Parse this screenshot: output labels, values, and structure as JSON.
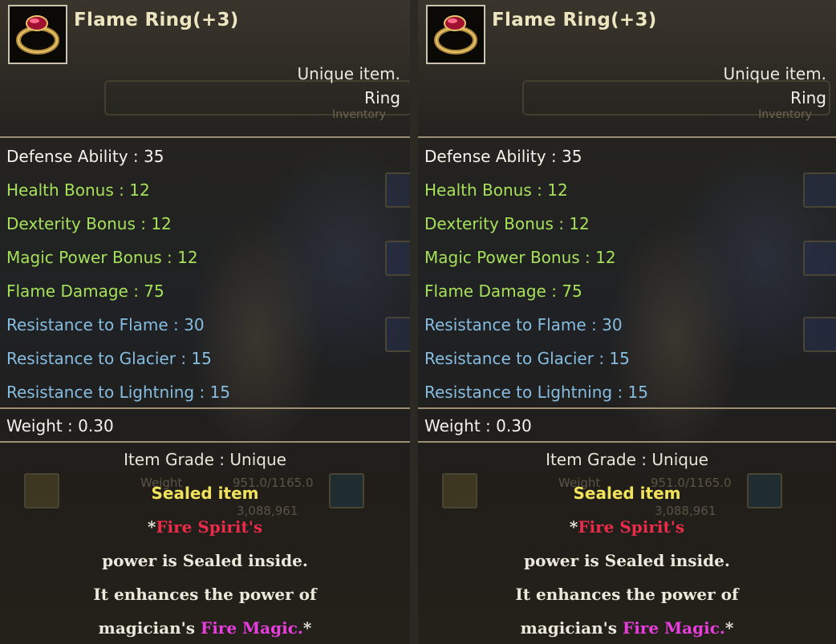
{
  "tooltip": {
    "title": "Flame Ring(+3)",
    "item_kind": "Unique item.",
    "item_slot": "Ring",
    "bg_label": "Inventory",
    "icon": "ruby-ring-icon",
    "stats": [
      {
        "text": "Defense Ability : 35",
        "color": "white"
      },
      {
        "text": "Health Bonus : 12",
        "color": "green"
      },
      {
        "text": "Dexterity Bonus : 12",
        "color": "green"
      },
      {
        "text": "Magic Power Bonus : 12",
        "color": "green"
      },
      {
        "text": "Flame Damage : 75",
        "color": "green"
      },
      {
        "text": "Resistance to Flame : 30",
        "color": "blue"
      },
      {
        "text": "Resistance to Glacier : 15",
        "color": "blue"
      },
      {
        "text": "Resistance to Lightning : 15",
        "color": "blue"
      }
    ],
    "weight": "Weight : 0.30",
    "item_grade": "Item Grade : Unique",
    "sealed": "Sealed item",
    "desc": {
      "star_open": "*",
      "spirit": "Fire Spirit's",
      "line2": "power is Sealed inside.",
      "line3": "It enhances the power of",
      "line4_prefix": "magician's ",
      "magic": "Fire Magic.",
      "star_close": "*"
    },
    "bg_weight_label": "Weight",
    "bg_weight_value": "951.0/1165.0",
    "bg_gold": "3,088,961"
  },
  "colors": {
    "green": "#a6e05a",
    "blue": "#86bde0",
    "red": "#ea2b4a",
    "pink": "#e83ee0",
    "yellow": "#f0e25a"
  }
}
